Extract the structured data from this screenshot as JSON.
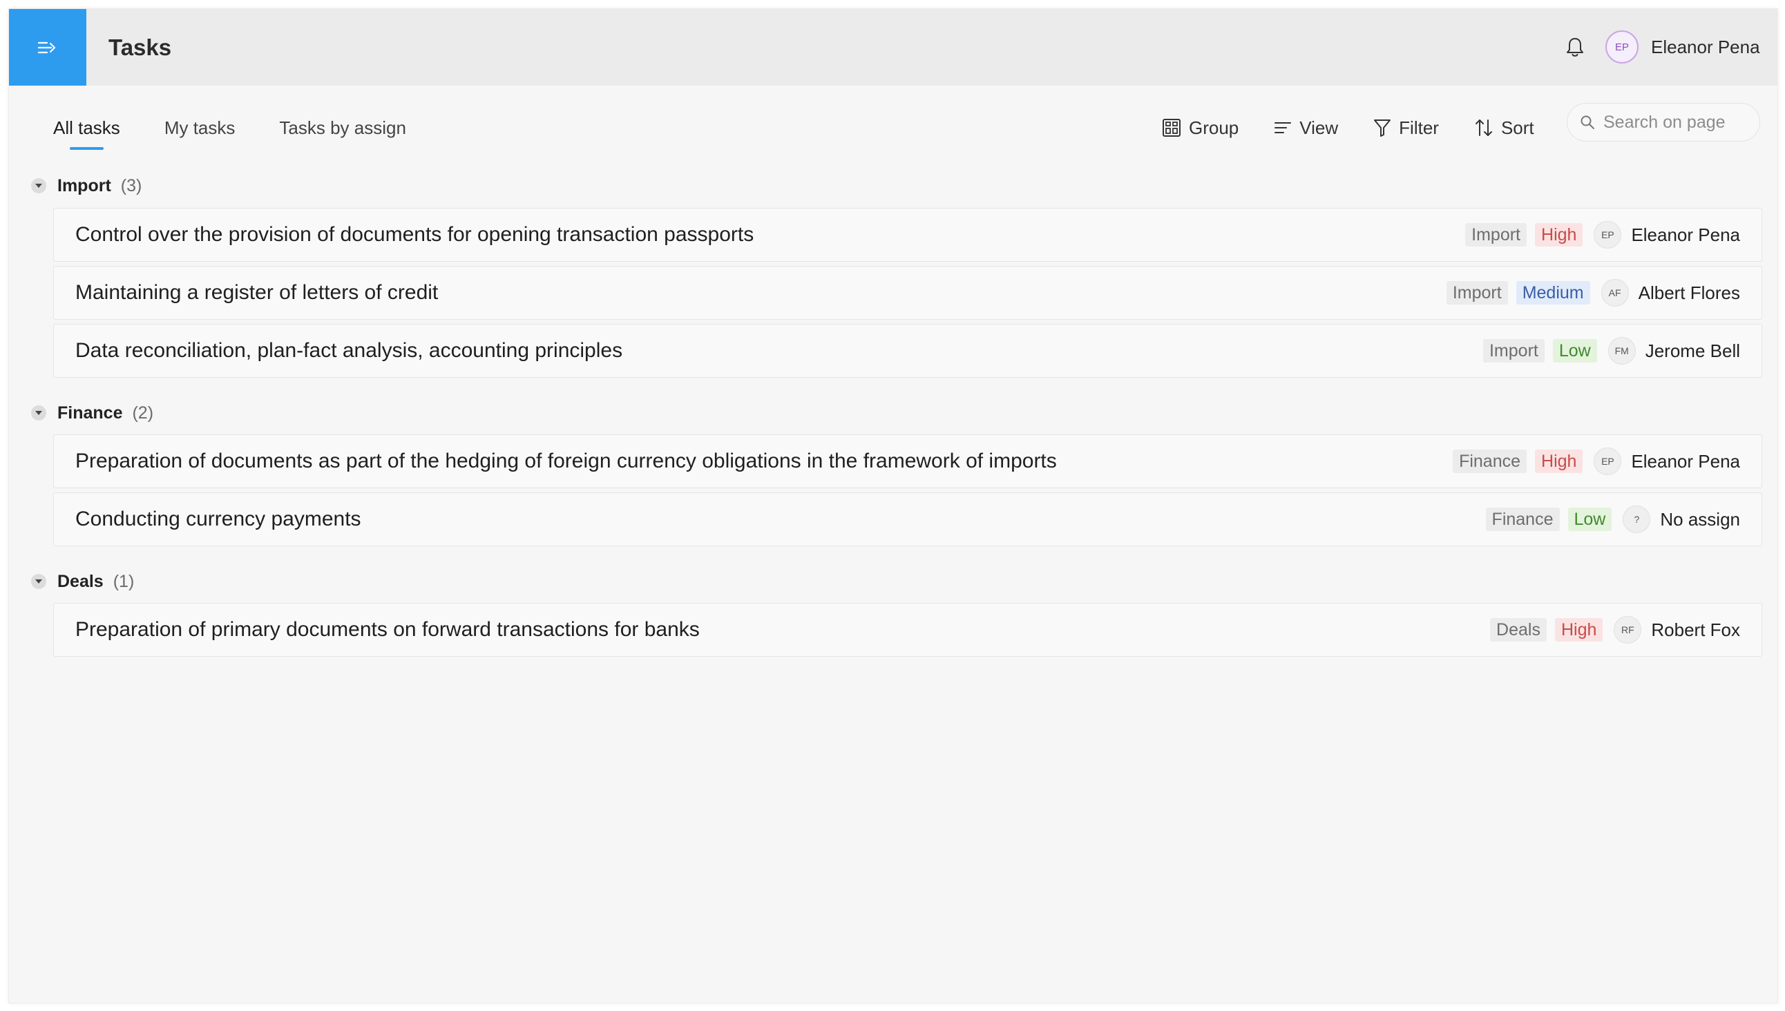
{
  "header": {
    "title": "Tasks",
    "user": {
      "initials": "EP",
      "name": "Eleanor Pena"
    }
  },
  "tabs": [
    "All tasks",
    "My tasks",
    "Tasks by assign"
  ],
  "toolbar": {
    "group": "Group",
    "view": "View",
    "filter": "Filter",
    "sort": "Sort",
    "search_placeholder": "Search on page"
  },
  "groups": [
    {
      "name": "Import",
      "count": "(3)",
      "tasks": [
        {
          "title": "Control over the provision of documents for opening transaction passports",
          "category": "Import",
          "priority": "High",
          "initials": "EP",
          "assignee": "Eleanor Pena"
        },
        {
          "title": "Maintaining a register of letters of credit",
          "category": "Import",
          "priority": "Medium",
          "initials": "AF",
          "assignee": "Albert Flores"
        },
        {
          "title": "Data reconciliation, plan-fact analysis, accounting principles",
          "category": "Import",
          "priority": "Low",
          "initials": "FM",
          "assignee": "Jerome Bell"
        }
      ]
    },
    {
      "name": "Finance",
      "count": "(2)",
      "tasks": [
        {
          "title": "Preparation of documents as part of the hedging of foreign currency obligations in the framework of imports",
          "category": "Finance",
          "priority": "High",
          "initials": "EP",
          "assignee": "Eleanor Pena"
        },
        {
          "title": "Conducting currency payments",
          "category": "Finance",
          "priority": "Low",
          "initials": "?",
          "assignee": "No assign"
        }
      ]
    },
    {
      "name": "Deals",
      "count": "(1)",
      "tasks": [
        {
          "title": "Preparation of primary documents on forward transactions for banks",
          "category": "Deals",
          "priority": "High",
          "initials": "RF",
          "assignee": "Robert Fox"
        }
      ]
    }
  ],
  "colors": {
    "accent": "#2d9cef",
    "high": "#c84b4b",
    "medium": "#3a5ea8",
    "low": "#3f8a2d"
  }
}
